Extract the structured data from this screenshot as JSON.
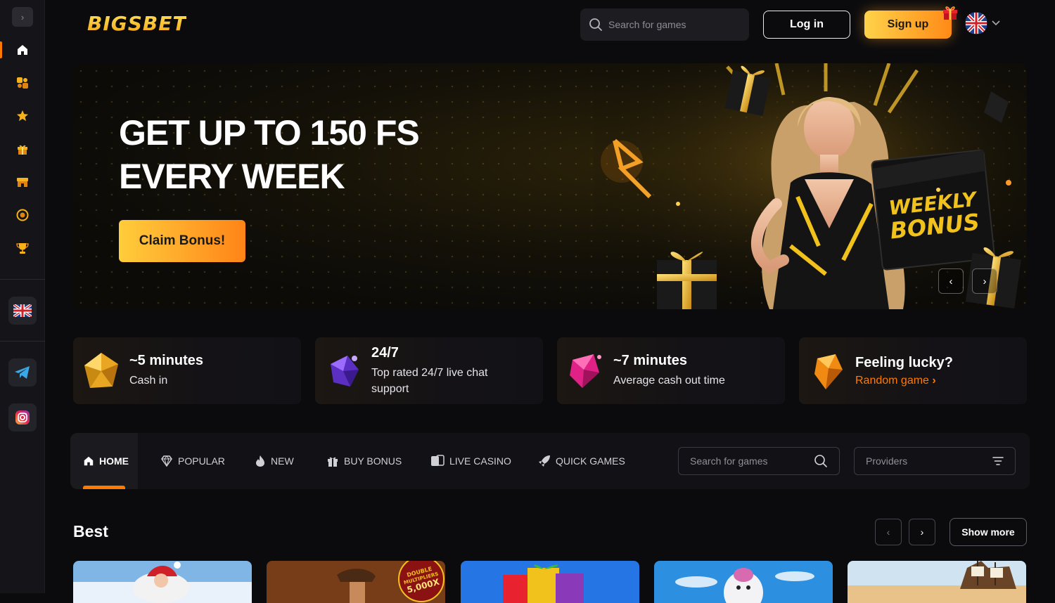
{
  "brand": {
    "logo_text": "BIGSBET",
    "accent": "#ff7a00",
    "gold": "#ffd24a"
  },
  "header": {
    "search_placeholder": "Search for games",
    "login_label": "Log in",
    "signup_label": "Sign up",
    "language_icon": "uk-flag-icon"
  },
  "sidebar": {
    "toggle_icon": "chevron-right-icon",
    "items": [
      {
        "icon": "home-icon",
        "active": true
      },
      {
        "icon": "slots-icon",
        "active": false
      },
      {
        "icon": "star-icon",
        "active": false
      },
      {
        "icon": "gift-icon",
        "active": false
      },
      {
        "icon": "shop-icon",
        "active": false
      },
      {
        "icon": "coin-icon",
        "active": false
      },
      {
        "icon": "trophy-icon",
        "active": false
      }
    ],
    "social": [
      "telegram-icon",
      "instagram-icon"
    ]
  },
  "banner": {
    "title_line1": "GET UP TO 150 FS",
    "title_line2": "EVERY WEEK",
    "cta": "Claim Bonus!",
    "art_text_line1": "WEEKLY",
    "art_text_line2": "BONUS",
    "prev_arrow": "‹",
    "next_arrow": "›"
  },
  "features": [
    {
      "title": "~5 minutes",
      "subtitle": "Cash in",
      "icon": "gold-gem-icon"
    },
    {
      "title": "24/7",
      "subtitle": "Top rated 24/7 live chat support",
      "icon": "purple-gem-icon"
    },
    {
      "title": "~7 minutes",
      "subtitle": "Average cash out time",
      "icon": "pink-gem-icon"
    },
    {
      "title": "Feeling lucky?",
      "link": "Random game",
      "icon": "orange-gem-icon"
    }
  ],
  "tabs": [
    {
      "label": "HOME",
      "icon": "home-icon",
      "active": true
    },
    {
      "label": "POPULAR",
      "icon": "diamond-icon",
      "active": false
    },
    {
      "label": "NEW",
      "icon": "flame-icon",
      "active": false
    },
    {
      "label": "BUY BONUS",
      "icon": "gift-icon",
      "active": false
    },
    {
      "label": "LIVE CASINO",
      "icon": "cards-icon",
      "active": false
    },
    {
      "label": "QUICK GAMES",
      "icon": "rocket-icon",
      "active": false
    }
  ],
  "tab_search_placeholder": "Search for games",
  "providers_label": "Providers",
  "best": {
    "title": "Best",
    "prev": "‹",
    "next": "›",
    "show_more": "Show more",
    "card_badge_line1": "DOUBLE",
    "card_badge_line2": "MULTIPLIERS",
    "card_badge_line3": "5,000X"
  }
}
